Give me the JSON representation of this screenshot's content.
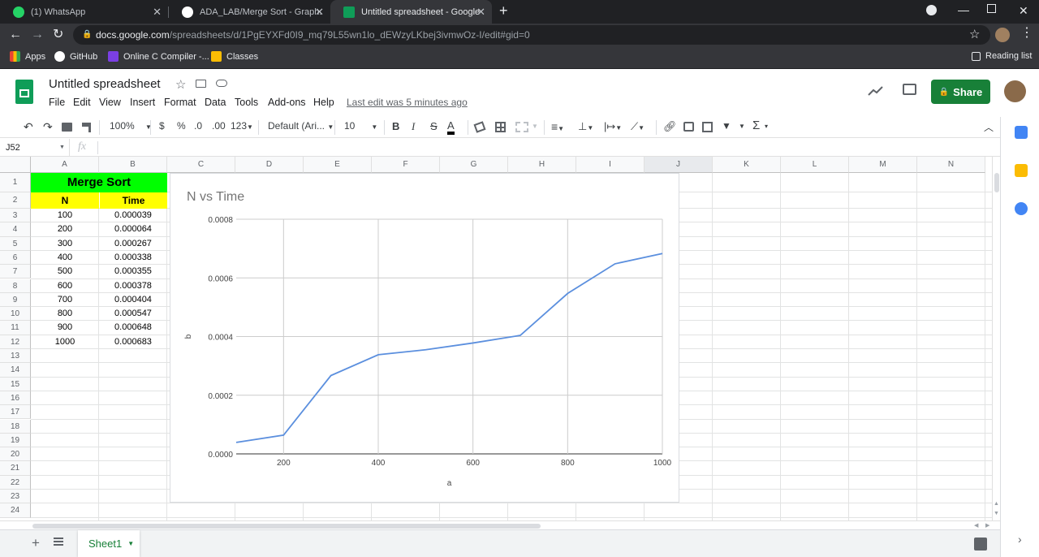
{
  "browser": {
    "tabs": [
      {
        "title": "(1) WhatsApp",
        "color": "#25d366"
      },
      {
        "title": "ADA_LAB/Merge Sort - Graph.pn",
        "color": "#ffffff"
      },
      {
        "title": "Untitled spreadsheet - Google Sh",
        "color": "#0f9d58"
      }
    ],
    "url_host": "docs.google.com",
    "url_path": "/spreadsheets/d/1PgEYXFd0I9_mq79L55wn1lo_dEWzyLKbej3ivmwOz-I/edit#gid=0",
    "bookmarks": [
      "Apps",
      "GitHub",
      "Online C Compiler -...",
      "Classes"
    ],
    "reading_list": "Reading list"
  },
  "sheets": {
    "doc_title": "Untitled spreadsheet",
    "menus": [
      "File",
      "Edit",
      "View",
      "Insert",
      "Format",
      "Data",
      "Tools",
      "Add-ons",
      "Help"
    ],
    "last_edit": "Last edit was 5 minutes ago",
    "share_label": "Share",
    "toolbar": {
      "zoom": "100%",
      "currency": "$",
      "percent": "%",
      "dec_decrease": ".0",
      "dec_increase": ".00",
      "number_format": "123",
      "font": "Default (Ari...",
      "font_size": "10",
      "bold": "B",
      "italic": "I",
      "strike": "S",
      "text_color": "A"
    },
    "name_box": "J52",
    "fx": "fx",
    "columns": [
      "A",
      "B",
      "C",
      "D",
      "E",
      "F",
      "G",
      "H",
      "I",
      "J",
      "K",
      "L",
      "M",
      "N"
    ],
    "rows": [
      "1",
      "2",
      "3",
      "4",
      "5",
      "6",
      "7",
      "8",
      "9",
      "10",
      "11",
      "12",
      "13",
      "14",
      "15",
      "16",
      "17",
      "18",
      "19",
      "20",
      "21",
      "22",
      "23",
      "24"
    ],
    "table": {
      "title": "Merge Sort",
      "header_n": "N",
      "header_time": "Time",
      "n": [
        "100",
        "200",
        "300",
        "400",
        "500",
        "600",
        "700",
        "800",
        "900",
        "1000"
      ],
      "time": [
        "0.000039",
        "0.000064",
        "0.000267",
        "0.000338",
        "0.000355",
        "0.000378",
        "0.000404",
        "0.000547",
        "0.000648",
        "0.000683"
      ]
    },
    "sheet_tab": "Sheet1",
    "colors": {
      "title_bg": "#00ff00",
      "header_bg": "#ffff00",
      "share": "#188038",
      "line": "#5b8fde"
    }
  },
  "chart_data": {
    "type": "line",
    "title": "N vs Time",
    "xlabel": "a",
    "ylabel": "b",
    "x": [
      100,
      200,
      300,
      400,
      500,
      600,
      700,
      800,
      900,
      1000
    ],
    "series": [
      {
        "values": [
          3.9e-05,
          6.4e-05,
          0.000267,
          0.000338,
          0.000355,
          0.000378,
          0.000404,
          0.000547,
          0.000648,
          0.000683
        ]
      }
    ],
    "xlim": [
      100,
      1000
    ],
    "ylim": [
      0,
      0.0008
    ],
    "xticks": [
      "200",
      "400",
      "600",
      "800",
      "1000"
    ],
    "yticks": [
      "0.0000",
      "0.0002",
      "0.0004",
      "0.0006",
      "0.0008"
    ],
    "grid": true
  }
}
